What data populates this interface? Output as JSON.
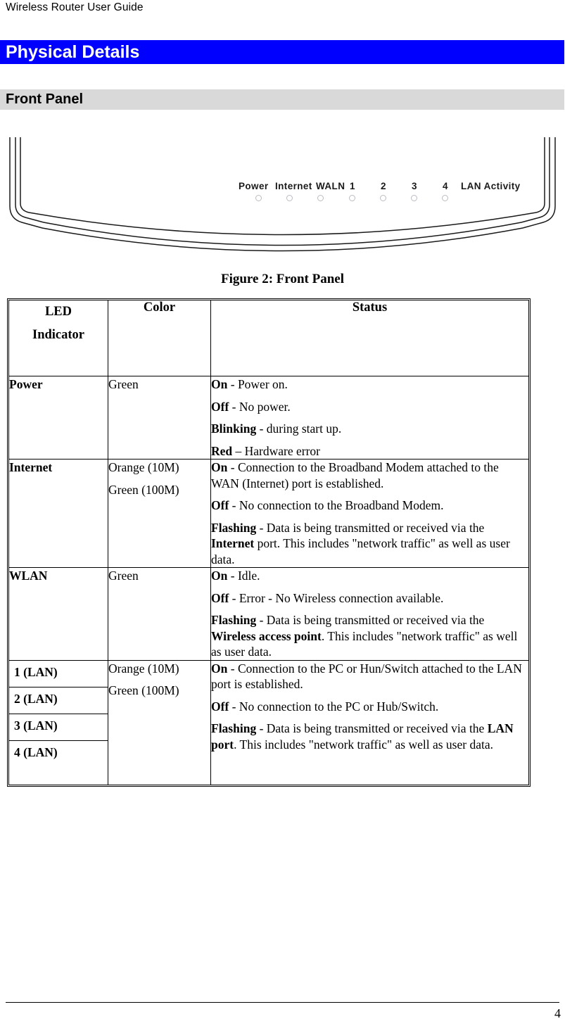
{
  "header": {
    "running_title": "Wireless Router User Guide"
  },
  "chapter": {
    "title": "Physical Details",
    "bar_color": "#0000ff",
    "text_color": "#ffffff"
  },
  "section": {
    "title": "Front Panel",
    "bar_color": "#d9d9d9"
  },
  "figure": {
    "caption": "Figure 2: Front Panel",
    "led_labels": [
      "Power",
      "Internet",
      "WALN",
      "1",
      "2",
      "3",
      "4",
      "LAN Activity"
    ],
    "led_dot_count": 7,
    "led_dot_color": "#b9bcc2"
  },
  "table": {
    "headers": {
      "indicator_line1": "LED",
      "indicator_line2": "Indicator",
      "color": "Color",
      "status": "Status"
    },
    "rows": [
      {
        "indicator": "Power",
        "color_lines": [
          "Green"
        ],
        "status": [
          {
            "label": "On",
            "dash": " - ",
            "text": "Power on."
          },
          {
            "label": "Off",
            "dash": " - ",
            "text": "No power."
          },
          {
            "label": "Blinking",
            "dash": " - ",
            "text": "during start up."
          },
          {
            "label": "Red",
            "dash": " – ",
            "text": "Hardware error"
          }
        ]
      },
      {
        "indicator": "Internet",
        "color_lines": [
          "Orange (10M)",
          "Green (100M)"
        ],
        "status": [
          {
            "label": "On",
            "dash": " - ",
            "text": "Connection to the Broadband Modem attached to the WAN (Internet) port is established."
          },
          {
            "label": "Off",
            "dash": " - ",
            "text": "No connection to the Broadband Modem."
          },
          {
            "label": "Flashing",
            "dash": " - ",
            "text": "Data is being transmitted or received via the ",
            "emphasis": "Internet",
            "text_after": " port. This includes \"network traffic\" as well as user data."
          }
        ]
      },
      {
        "indicator": "WLAN",
        "color_lines": [
          "Green"
        ],
        "status": [
          {
            "label": "On",
            "dash": " - ",
            "text": "Idle."
          },
          {
            "label": "Off",
            "dash": " - ",
            "text": "Error - No Wireless connection available."
          },
          {
            "label": "Flashing",
            "dash": " - ",
            "text": "Data is being transmitted or received via the ",
            "emphasis": "Wireless access point",
            "text_after": ". This includes \"network traffic\" as well as user data."
          }
        ]
      },
      {
        "indicator_group": [
          "1 (LAN)",
          "2 (LAN)",
          "3 (LAN)",
          "4 (LAN)"
        ],
        "color_lines": [
          "Orange (10M)",
          "Green (100M)"
        ],
        "status": [
          {
            "label": "On",
            "dash": " - ",
            "text": "Connection to the PC or Hun/Switch attached to the LAN port is established."
          },
          {
            "label": "Off",
            "dash": " - ",
            "text": "No connection to the PC or Hub/Switch."
          },
          {
            "label": "Flashing",
            "dash": " - ",
            "text": "Data is being transmitted or received via the ",
            "emphasis": "LAN port",
            "text_after": ". This includes \"network traffic\" as well as user data."
          }
        ]
      }
    ]
  },
  "footer": {
    "page_number": "4"
  }
}
